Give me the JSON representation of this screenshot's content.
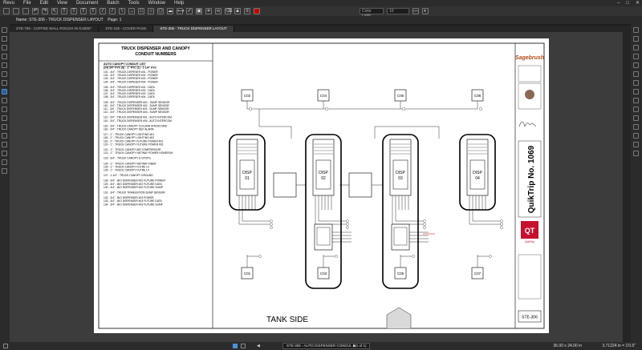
{
  "app": {
    "name": "Revu"
  },
  "menu": [
    "Revu",
    "File",
    "Edit",
    "View",
    "Document",
    "Batch",
    "Tools",
    "Window",
    "Help"
  ],
  "toolbar": {
    "color_label": "Color Light",
    "font_size": "10"
  },
  "document": {
    "title": "Name: STE-306 - TRUCK DISPENSER LAYOUT",
    "page_label": "Page: 1"
  },
  "tabs": [
    {
      "label": "STE-709 - COFFEE WALL ROUGH IN GUIDE*"
    },
    {
      "label": "STE-105 - COVER PAGE"
    },
    {
      "label": "STE-306 - TRUCK DISPENSER LAYOUT"
    }
  ],
  "sheet": {
    "header_title": "TRUCK DISPENSER AND CANOPY\nCONDUIT NUMBERS",
    "list_title": "AUTO CANOPY CONDUIT LIST",
    "list_subtitle": "(24) 3/4\" PVC  (8) - 1\" PVC  (1) - 1-1/4\" PVC",
    "conduits": [
      "101 - 3/4\" - TRUCK DISPESER #01 - POWER",
      "102 - 3/4\" - TRUCK DISPESER #02 - POWER",
      "103 - 3/4\" - TRUCK DISPESER #03 - POWER",
      "104 - 3/4\" - TRUCK DISPESER #04 - POWER",
      "",
      "105 - 3/4\" - TRUCK DISPESER #01 - DATA",
      "106 - 3/4\" - TRUCK DISPESER #02 - DATA",
      "107 - 3/4\" - TRUCK DISPESER #03 - DATA",
      "108 - 3/4\" - TRUCK DISPESER #04 - DATA",
      "",
      "109 - 3/4\" - TRUCK DISPENSER #01 - SUMP SENSOR",
      "110 - 3/4\" - TRUCK DISPENSER #02 - SUMP SENSOR",
      "111 - 3/4\" - TRUCK DISPENSER #03 - SUMP SENSOR",
      "112 - 3/4\" - TRUCK DISPENSER #04 - SUMP SENSOR",
      "",
      "113 - 3/4\" - TRUCK DISPENSER #01 - AUTO INTERCOM",
      "114 - 3/4\" - TRUCK DISPENSER #04 - AUTO INTERCOM",
      "",
      "115 - 3/4\" - TRUCK CANOPY COLUMN INTERCOMS",
      "116 - 3/4\" - TRUCK CANOPY DEF ALARM",
      "",
      "117 - 1\" - TRUCK CANOPY LIGHTING #01",
      "118 - 1\" - TRUCK CANOPY LIGHTING #02",
      "119 - 1\" - TRUCK CANOPY FUTURE POWER #01",
      "120 - 1\" - TRUCK CANOPY FUTURE POWER #02",
      "",
      "121 - 1\" - TRUCK CANOPY AIR COMPRESSOR",
      "122 - 1\" - TRUCK CANOPY NETWAY POWER HOMERUN",
      "",
      "123 - 3/4\" - TRUCK CANOPY E-STOPS",
      "",
      "124 - 1\" - TRUCK CANOPY NETWAY FIBER",
      "125 - 1\" - TRUCK CANOPY FUTRE LV",
      "126 - 1\" - TRUCK CANOPY FUTRE LV",
      "",
      "127 - 1-1/4\" - TRUCK CANOPY GROUND",
      "",
      "128 - 3/4\" - BIO DISPENSER #02 FUTURE POWER",
      "129 - 3/4\" - BIO DISPENSER #02 FUTURE DATA",
      "130 - 3/4\" - BIO DISPENSER #02 FUTURE SUMP",
      "",
      "131 - 3/4\" - TRUCK TRANSISTION SUMP SENSOR",
      "",
      "132 - 3/4\" - BIO DISPENSER #03 POWER",
      "133 - 3/4\" - BIO DISPENSER #03 FUTURE DATA",
      "134 - 3/4\" - BIO DISPENSER #03 FUTURE SUMP"
    ],
    "columns_top": [
      "C02",
      "C04",
      "C06",
      "C08"
    ],
    "columns_bottom": [
      "C01",
      "C03",
      "C05",
      "C07"
    ],
    "dispensers": [
      "DISP\n01",
      "DISP\n02",
      "DISP\n03",
      "DISP\n04"
    ],
    "tank_side": "TANK SIDE",
    "title_block": {
      "brand": "Sagebrush",
      "project": "QuikTrip No. 1069",
      "qt_logo": "QT",
      "qt_word": "QuikTrip",
      "sheet_no": "STE-306"
    }
  },
  "status": {
    "page_nav": "1 of 1",
    "page_name": "STE-306 - AUTO DISPENSER CONDUI...",
    "dimensions": "36.00 x 24.00 in",
    "zoom": "3.71224 in = 1'0.5\""
  },
  "colors": {
    "accent": "#4a90d9",
    "qt_red": "#c8102e",
    "canvas": "#3c3c3c"
  }
}
